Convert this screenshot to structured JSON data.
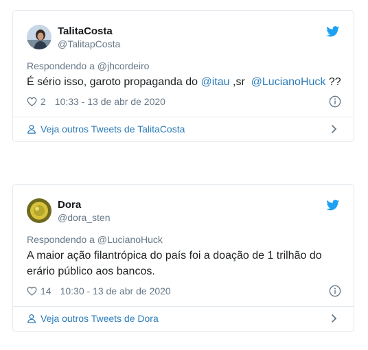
{
  "tweets": [
    {
      "author_name": "TalitaCosta",
      "author_handle": "@TalitapCosta",
      "replying_prefix": "Respondendo a ",
      "replying_to": "@jhcordeiro",
      "text_before": "É sério isso, garoto propaganda do ",
      "mention1": "@itau",
      "text_middle": " ,sr  ",
      "mention2": "@LucianoHuck",
      "text_after": " ??",
      "likes": "2",
      "timestamp": "10:33 - 13 de abr de 2020",
      "more_tweets_label": "Veja outros Tweets de TalitaCosta"
    },
    {
      "author_name": "Dora",
      "author_handle": "@dora_sten",
      "replying_prefix": "Respondendo a ",
      "replying_to": "@LucianoHuck",
      "text": "A maior ação filantrópica do país foi a doação de 1 trilhão do erário público aos bancos.",
      "likes": "14",
      "timestamp": "10:30 - 13 de abr de 2020",
      "more_tweets_label": "Veja outros Tweets de Dora"
    }
  ],
  "colors": {
    "link": "#2b7bb9",
    "muted": "#657786",
    "border": "#e1e8ed",
    "twitter_blue": "#1da1f2"
  },
  "icons": [
    "twitter-bird-icon",
    "heart-icon",
    "info-icon",
    "person-icon",
    "chevron-right-icon"
  ]
}
